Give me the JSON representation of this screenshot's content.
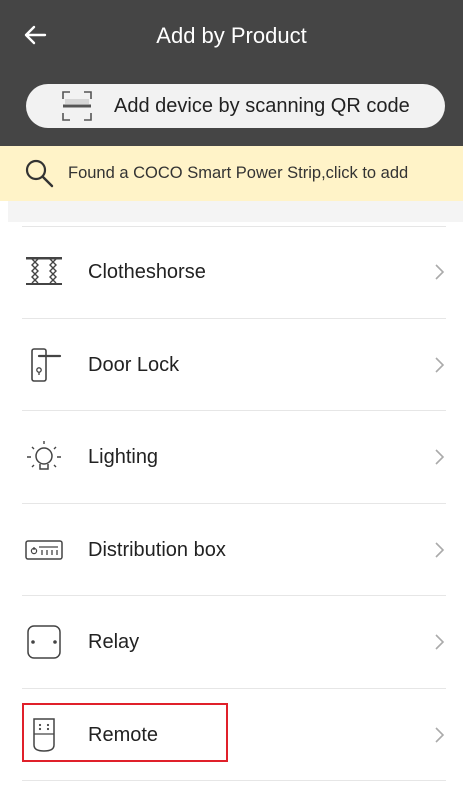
{
  "header": {
    "title": "Add by Product",
    "back_icon": "arrow-left-icon",
    "scan_button_label": "Add device by scanning QR code",
    "scan_icon": "qr-scan-icon",
    "background_color": "#454545"
  },
  "found_banner": {
    "text": "Found a COCO Smart Power Strip,click to add",
    "icon": "search-icon",
    "background_color": "#fff3c8"
  },
  "categories": [
    {
      "label": "Clotheshorse",
      "icon": "clotheshorse-icon"
    },
    {
      "label": "Door Lock",
      "icon": "door-lock-icon"
    },
    {
      "label": "Lighting",
      "icon": "light-bulb-icon"
    },
    {
      "label": "Distribution box",
      "icon": "distribution-box-icon"
    },
    {
      "label": "Relay",
      "icon": "relay-icon"
    },
    {
      "label": "Remote",
      "icon": "remote-control-icon"
    }
  ],
  "highlight": {
    "target": "Remote",
    "color": "#e0202a"
  }
}
